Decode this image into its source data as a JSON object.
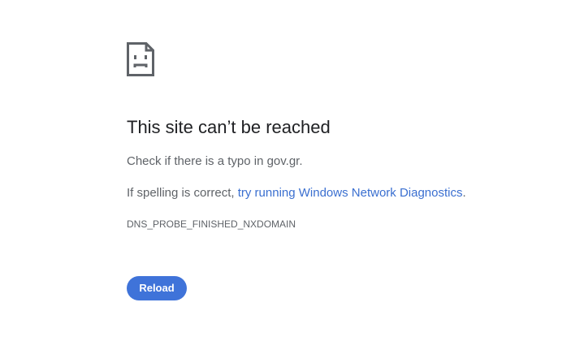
{
  "page": {
    "icon": "sad-page-icon",
    "title": "This site can’t be reached",
    "line1": "Check if there is a typo in gov.gr.",
    "line2_prefix": "If spelling is correct, ",
    "line2_link": "try running Windows Network Diagnostics",
    "line2_suffix": ".",
    "error_code": "DNS_PROBE_FINISHED_NXDOMAIN",
    "reload_label": "Reload"
  },
  "colors": {
    "background": "#ffffff",
    "title": "#202124",
    "text": "#5f6368",
    "link": "#3a6fd0",
    "button": "#3f73d9"
  }
}
